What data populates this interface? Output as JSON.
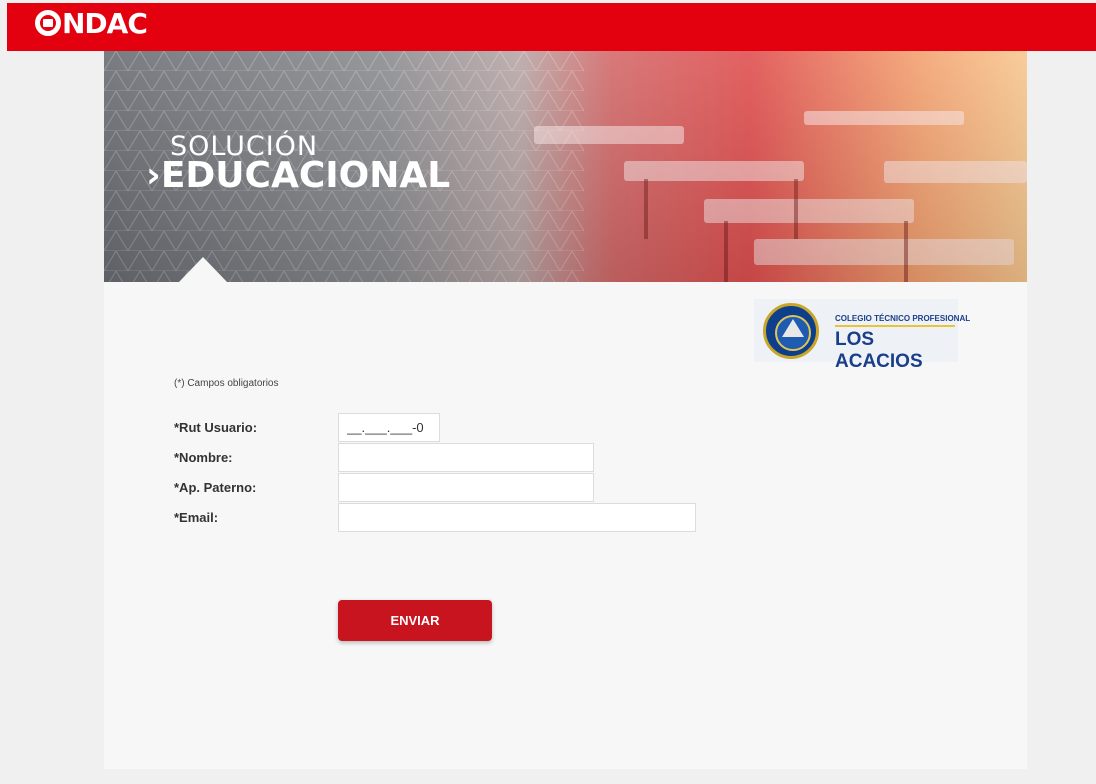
{
  "header": {
    "logo_text": "ONDAC",
    "logo_letters": "NDAC",
    "brand_color": "#e3000f"
  },
  "banner": {
    "title_line1": "SOLUCIÓN",
    "title_line2": "›EDUCACIONAL"
  },
  "school": {
    "line1": "COLEGIO TÉCNICO PROFESIONAL",
    "line2": "LOS ACACIOS"
  },
  "form": {
    "required_note": "(*) Campos obligatorios",
    "fields": [
      {
        "label": "*Rut Usuario:",
        "value": "",
        "placeholder": "__.___.___-0"
      },
      {
        "label": "*Nombre:",
        "value": "",
        "placeholder": ""
      },
      {
        "label": "*Ap. Paterno:",
        "value": "",
        "placeholder": ""
      },
      {
        "label": "*Email:",
        "value": "",
        "placeholder": ""
      }
    ],
    "submit_label": "ENVIAR",
    "button_color": "#c8141e"
  }
}
